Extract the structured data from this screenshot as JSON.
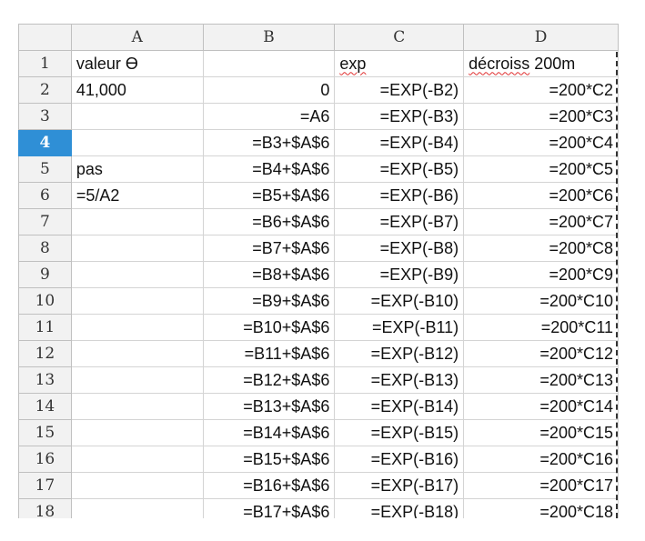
{
  "sheet": {
    "columns": [
      "A",
      "B",
      "C",
      "D"
    ],
    "rows": [
      {
        "n": "1",
        "a": "valeur ϴ",
        "b": "",
        "c": "exp",
        "d": "décroiss 200m"
      },
      {
        "n": "2",
        "a": "41,000",
        "b": "0",
        "c": "=EXP(-B2)",
        "d": "=200*C2"
      },
      {
        "n": "3",
        "a": "",
        "b": "=A6",
        "c": "=EXP(-B3)",
        "d": "=200*C3"
      },
      {
        "n": "4",
        "a": "",
        "b": "=B3+$A$6",
        "c": "=EXP(-B4)",
        "d": "=200*C4"
      },
      {
        "n": "5",
        "a": "pas",
        "b": "=B4+$A$6",
        "c": "=EXP(-B5)",
        "d": "=200*C5"
      },
      {
        "n": "6",
        "a": "=5/A2",
        "b": "=B5+$A$6",
        "c": "=EXP(-B6)",
        "d": "=200*C6"
      },
      {
        "n": "7",
        "a": "",
        "b": "=B6+$A$6",
        "c": "=EXP(-B7)",
        "d": "=200*C7"
      },
      {
        "n": "8",
        "a": "",
        "b": "=B7+$A$6",
        "c": "=EXP(-B8)",
        "d": "=200*C8"
      },
      {
        "n": "9",
        "a": "",
        "b": "=B8+$A$6",
        "c": "=EXP(-B9)",
        "d": "=200*C9"
      },
      {
        "n": "10",
        "a": "",
        "b": "=B9+$A$6",
        "c": "=EXP(-B10)",
        "d": "=200*C10"
      },
      {
        "n": "11",
        "a": "",
        "b": "=B10+$A$6",
        "c": "=EXP(-B11)",
        "d": "=200*C11"
      },
      {
        "n": "12",
        "a": "",
        "b": "=B11+$A$6",
        "c": "=EXP(-B12)",
        "d": "=200*C12"
      },
      {
        "n": "13",
        "a": "",
        "b": "=B12+$A$6",
        "c": "=EXP(-B13)",
        "d": "=200*C13"
      },
      {
        "n": "14",
        "a": "",
        "b": "=B13+$A$6",
        "c": "=EXP(-B14)",
        "d": "=200*C14"
      },
      {
        "n": "15",
        "a": "",
        "b": "=B14+$A$6",
        "c": "=EXP(-B15)",
        "d": "=200*C15"
      },
      {
        "n": "16",
        "a": "",
        "b": "=B15+$A$6",
        "c": "=EXP(-B16)",
        "d": "=200*C16"
      },
      {
        "n": "17",
        "a": "",
        "b": "=B16+$A$6",
        "c": "=EXP(-B17)",
        "d": "=200*C17"
      },
      {
        "n": "18",
        "a": "",
        "b": "=B17+$A$6",
        "c": "=EXP(-B18)",
        "d": "=200*C18"
      }
    ],
    "active_row": "4"
  }
}
